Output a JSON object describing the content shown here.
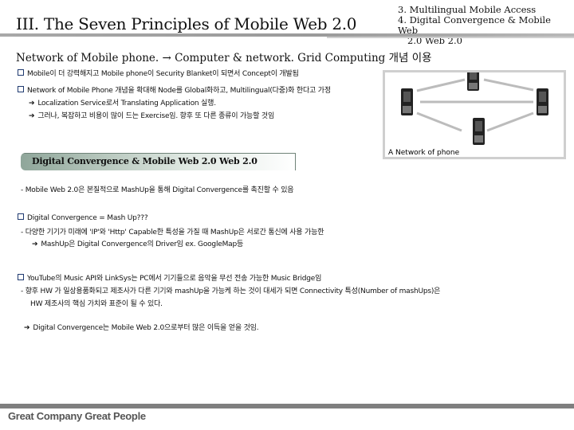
{
  "header": {
    "title": "III. The Seven Principles of Mobile Web 2.0",
    "toc": [
      "3. Multilingual Mobile Access",
      "4. Digital Convergence & Mobile",
      "Web",
      "2.0 Web 2.0"
    ]
  },
  "section1": {
    "subtitle": "Network of Mobile phone. → Computer & network. Grid Computing 개념 이용",
    "bullets": [
      "Mobile이 더 강력해지고 Mobile phone이 Security Blanket이 되면서 Concept이 개발됨",
      "Network of Mobile Phone 개념을 확대해 Node를 Global화하고, Multilingual(다중)화 한다고 가정"
    ],
    "arrows": [
      "Localization Service로서 Translating Application 실행.",
      "그러나, 복잡하고 비용이 많이 드는 Exercise임. 향후 또 다른 종류이 가능할 것임"
    ],
    "figure_caption": "A Network of phone"
  },
  "section2": {
    "banner": "Digital Convergence & Mobile Web 2.0 Web 2.0",
    "dash1": "- Mobile Web 2.0은 본질적으로 MashUp을 통해 Digital Convergence를 촉진할 수 있음",
    "q1": "Digital Convergence = Mash Up???",
    "q1_dash": "- 다양한 기기가 미래에 'IP'와 'Http' Capable한 특성을 가질 때 MashUp은 서로간 통신에 사용 가능한",
    "q1_arrow": "MashUp은 Digital Convergence의 Driver임   ex. GoogleMap등",
    "q2": "YouTube의 Music API와 LinkSys는 PC에서 기기들으로 음악을 무선 전송 가능한 Music Bridge임",
    "q2_dash": "- 향후 HW 가 일상용품화되고 제조사가 다른 기기와 mashUp을 가능케 하는 것이 대세가 되면 Connectivity 특성(Number of mashUps)은",
    "q2_dash_cont": "HW 제조사의 핵심 가치와 표준이 될 수 있다.",
    "conclusion": "Digital Convergence는 Mobile Web 2.0으로부터 많은 이득을 얻을 것임."
  },
  "footer": {
    "slogan": "Great Company  Great People"
  }
}
